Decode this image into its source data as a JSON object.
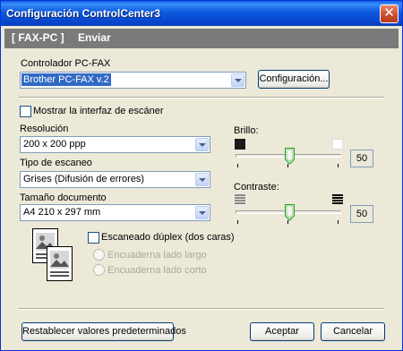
{
  "window": {
    "title": "Configuración ControlCenter3"
  },
  "header": {
    "tab1": "[ FAX-PC ]",
    "tab2": "Enviar"
  },
  "driver": {
    "label": "Controlador PC-FAX",
    "selected": "Brother PC-FAX v.2",
    "config_button": "Configuración..."
  },
  "scanner_ui": {
    "label": "Mostrar la interfaz de escáner",
    "checked": false
  },
  "resolution": {
    "label": "Resolución",
    "selected": "200 x 200 ppp"
  },
  "scan_type": {
    "label": "Tipo de escaneo",
    "selected": "Grises (Difusión de errores)"
  },
  "doc_size": {
    "label": "Tamaño documento",
    "selected": "A4 210 x 297 mm"
  },
  "brightness": {
    "label": "Brillo:",
    "value": "50",
    "level": 0.5
  },
  "contrast": {
    "label": "Contraste:",
    "value": "50",
    "level": 0.5
  },
  "duplex": {
    "label": "Escaneado dúplex (dos caras)",
    "checked": false,
    "long_edge": "Encuaderna lado largo",
    "short_edge": "Encuaderna lado corto"
  },
  "footer": {
    "reset_button": "Restablecer valores predeterminados",
    "ok_button": "Aceptar",
    "cancel_button": "Cancelar"
  }
}
